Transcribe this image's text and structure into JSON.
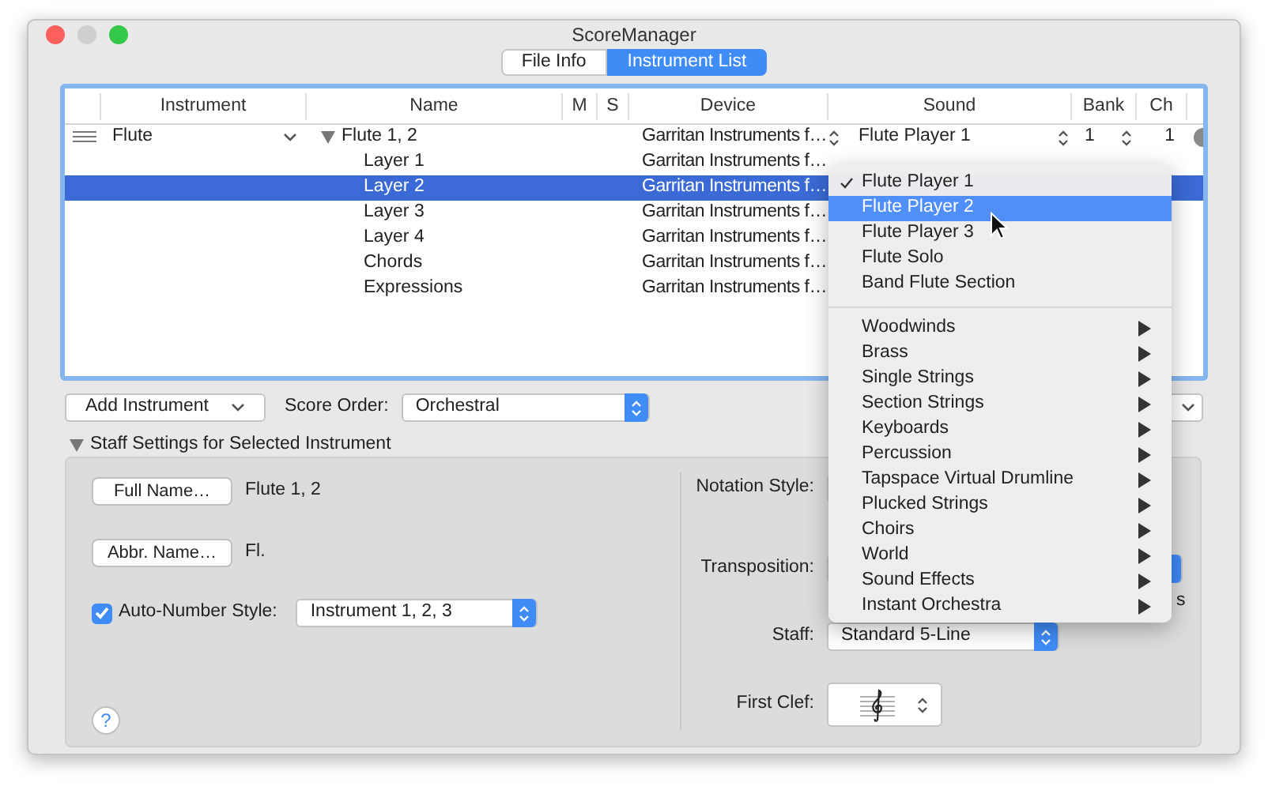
{
  "window": {
    "title": "ScoreManager"
  },
  "tabs": [
    {
      "label": "File Info",
      "selected": false
    },
    {
      "label": "Instrument List",
      "selected": true
    }
  ],
  "table": {
    "columns": [
      "Instrument",
      "Name",
      "M",
      "S",
      "Device",
      "Sound",
      "Bank",
      "Ch"
    ],
    "rows": [
      {
        "instrument": "Flute",
        "name": "Flute 1, 2",
        "expanded": true,
        "device": "Garritan Instruments f…",
        "sound": "Flute Player 1",
        "bank": "1",
        "ch": "1",
        "selected": false,
        "children": [
          {
            "name": "Layer 1",
            "device": "Garritan Instruments f…",
            "selected": false
          },
          {
            "name": "Layer 2",
            "device": "Garritan Instruments f…",
            "selected": true
          },
          {
            "name": "Layer 3",
            "device": "Garritan Instruments f…",
            "selected": false
          },
          {
            "name": "Layer 4",
            "device": "Garritan Instruments f…",
            "selected": false
          },
          {
            "name": "Chords",
            "device": "Garritan Instruments f…",
            "selected": false
          },
          {
            "name": "Expressions",
            "device": "Garritan Instruments f…",
            "selected": false
          }
        ]
      }
    ]
  },
  "toolbar": {
    "add_instrument": "Add Instrument",
    "score_order_label": "Score Order:",
    "score_order": "Orchestral"
  },
  "staff_settings": {
    "title": "Staff Settings for Selected Instrument",
    "expanded": true,
    "full_name_button": "Full Name…",
    "full_name": "Flute 1, 2",
    "abbr_name_button": "Abbr. Name…",
    "abbr_name": "Fl.",
    "auto_number": {
      "label": "Auto-Number Style:",
      "checked": true,
      "value": "Instrument 1, 2, 3"
    },
    "notation_style_label": "Notation Style:",
    "transposition_label": "Transposition:",
    "cut_text": "s",
    "staff_label": "Staff:",
    "staff": "Standard 5-Line",
    "first_clef_label": "First Clef:",
    "help_button": "?"
  },
  "sound_menu": {
    "items": [
      {
        "kind": "item",
        "label": "Flute Player 1",
        "checked": true,
        "selected": false
      },
      {
        "kind": "item",
        "label": "Flute Player 2",
        "checked": false,
        "selected": true
      },
      {
        "kind": "item",
        "label": "Flute Player 3",
        "checked": false,
        "selected": false
      },
      {
        "kind": "item",
        "label": "Flute Solo",
        "checked": false,
        "selected": false
      },
      {
        "kind": "item",
        "label": "Band Flute Section",
        "checked": false,
        "selected": false
      },
      {
        "kind": "separator"
      },
      {
        "kind": "submenu",
        "label": "Woodwinds"
      },
      {
        "kind": "submenu",
        "label": "Brass"
      },
      {
        "kind": "submenu",
        "label": "Single Strings"
      },
      {
        "kind": "submenu",
        "label": "Section Strings"
      },
      {
        "kind": "submenu",
        "label": "Keyboards"
      },
      {
        "kind": "submenu",
        "label": "Percussion"
      },
      {
        "kind": "submenu",
        "label": "Tapspace Virtual Drumline"
      },
      {
        "kind": "submenu",
        "label": "Plucked Strings"
      },
      {
        "kind": "submenu",
        "label": "Choirs"
      },
      {
        "kind": "submenu",
        "label": "World"
      },
      {
        "kind": "submenu",
        "label": "Sound Effects"
      },
      {
        "kind": "submenu",
        "label": "Instant Orchestra"
      }
    ]
  }
}
